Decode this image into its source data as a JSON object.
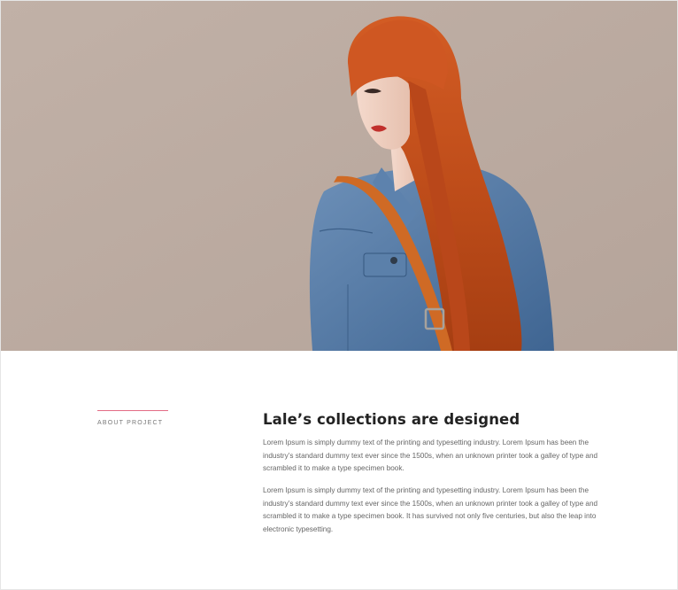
{
  "hero": {
    "image": "portrait-woman-red-hair-denim-jacket",
    "colors": {
      "backdrop": "#bcaca2",
      "hair": "#c4501b",
      "denim": "#4f77a6",
      "strap": "#cf6a25"
    }
  },
  "section": {
    "label": "ABOUT PROJECT",
    "accent_color": "#e36c86"
  },
  "article": {
    "title": "Lale’s collections are designed",
    "paragraph_1": [
      "Lorem Ipsum is simply dummy text of the printing and typesetting industry. Lorem Ipsum has been the",
      "industry’s standard dummy text ever since the 1500s, when an unknown printer took a galley of type and",
      "scrambled it to make a type specimen book."
    ],
    "paragraph_2": [
      "Lorem Ipsum is simply dummy text of the printing and typesetting industry. Lorem Ipsum has been the",
      "industry’s standard dummy text ever since the 1500s, when an unknown printer took a galley of type and",
      "scrambled it to make a type specimen book. It has survived not only five centuries, but also the leap into",
      "electronic typesetting."
    ]
  }
}
